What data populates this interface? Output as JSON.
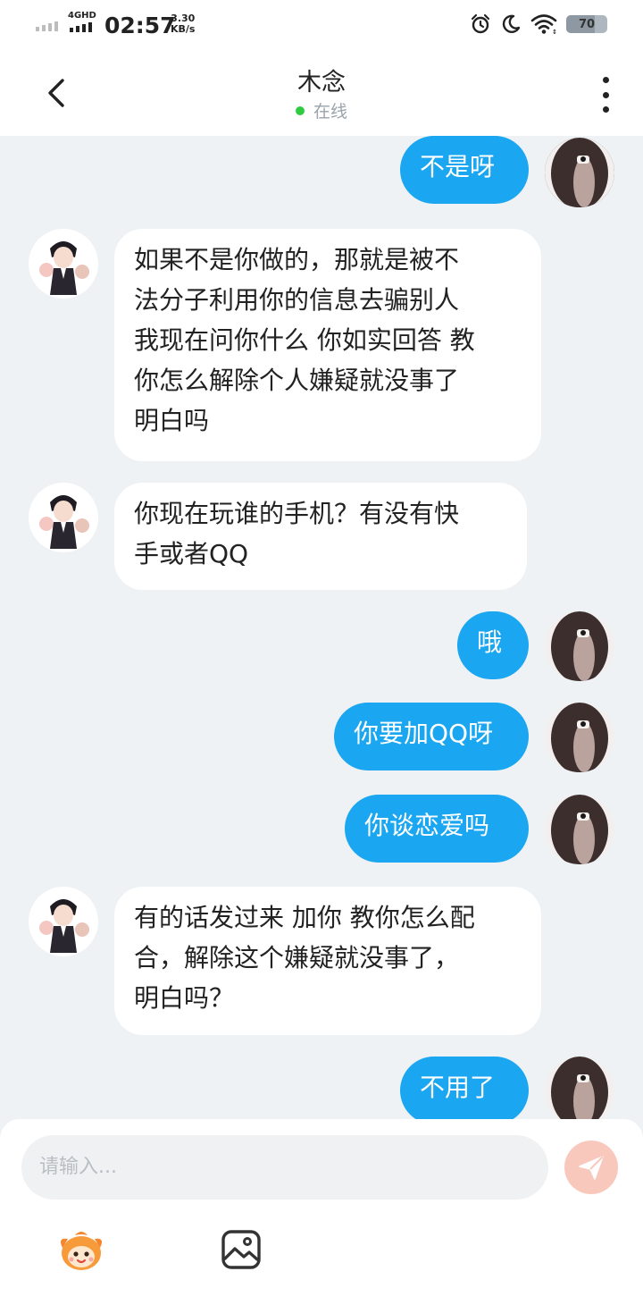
{
  "status_bar": {
    "network": "4GHD",
    "time": "02:57",
    "speed_value": "3.30",
    "speed_unit": "KB/s",
    "battery": "70",
    "battery_level_percent": 70
  },
  "header": {
    "title": "木念",
    "status": "在线",
    "status_color": "#2ecc40"
  },
  "messages": [
    {
      "side": "out",
      "text": "不是呀"
    },
    {
      "side": "in",
      "text": "如果不是你做的，那就是被不\n法分子利用你的信息去骗别人\n我现在问你什么 你如实回答 教\n你怎么解除个人嫌疑就没事了\n明白吗"
    },
    {
      "side": "in",
      "text": "你现在玩谁的手机？有没有快\n手或者QQ"
    },
    {
      "side": "out",
      "text": "哦"
    },
    {
      "side": "out",
      "text": "你要加QQ呀"
    },
    {
      "side": "out",
      "text": "你谈恋爱吗"
    },
    {
      "side": "in",
      "text": "有的话发过来 加你 教你怎么配\n合，解除这个嫌疑就没事了，\n明白吗？"
    },
    {
      "side": "out",
      "text": "不用了"
    }
  ],
  "composer": {
    "placeholder": "请输入..."
  },
  "colors": {
    "outgoing_bubble": "#1aa6f0",
    "incoming_bubble": "#ffffff",
    "chat_background": "#eef2f5",
    "send_button": "#f9c8bd"
  },
  "icons": [
    "back-arrow-icon",
    "more-vertical-icon",
    "alarm-icon",
    "moon-icon",
    "wifi-icon",
    "send-icon",
    "emoji-mascot-icon",
    "image-icon"
  ]
}
